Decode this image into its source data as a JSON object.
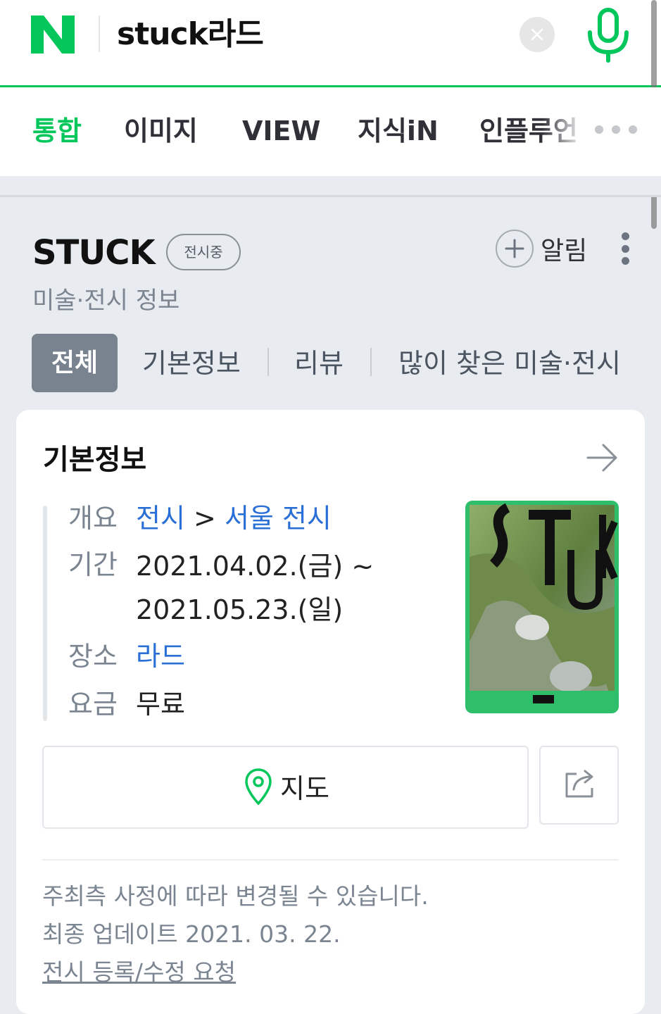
{
  "search": {
    "logo": "N",
    "query": "stuck라드"
  },
  "tabs": [
    {
      "label": "통합",
      "active": true
    },
    {
      "label": "이미지",
      "active": false
    },
    {
      "label": "VIEW",
      "active": false
    },
    {
      "label": "지식iN",
      "active": false
    },
    {
      "label": "인플루언",
      "active": false
    }
  ],
  "result": {
    "title": "STUCK",
    "status_badge": "전시중",
    "category": "미술·전시 정보",
    "alarm_label": "알림",
    "subtabs": [
      "전체",
      "기본정보",
      "리뷰",
      "많이 찾은 미술·전시"
    ]
  },
  "card": {
    "title": "기본정보",
    "rows": {
      "overview_label": "개요",
      "overview_link1": "전시",
      "overview_sep": ">",
      "overview_link2": "서울 전시",
      "period_label": "기간",
      "period_line1": "2021.04.02.(금) ~",
      "period_line2": "2021.05.23.(일)",
      "place_label": "장소",
      "place_value": "라드",
      "fee_label": "요금",
      "fee_value": "무료"
    },
    "map_button": "지도",
    "notice": "주최측 사정에 따라 변경될 수 있습니다.",
    "updated": "최종 업데이트 2021. 03. 22.",
    "request_link": "전시 등록/수정 요청"
  },
  "colors": {
    "brand_green": "#03c75a",
    "link_blue": "#2a6fd6",
    "subtab_active_bg": "#78838f"
  }
}
